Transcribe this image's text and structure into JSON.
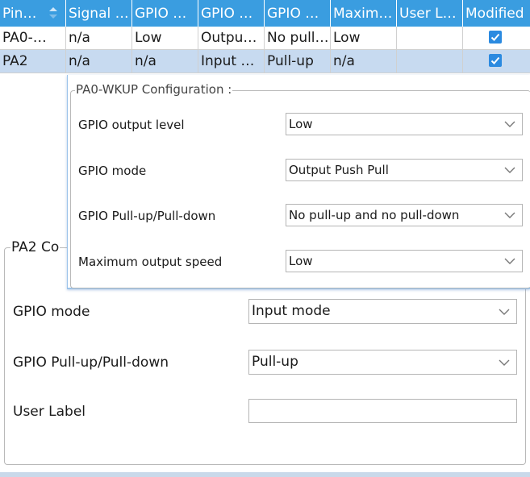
{
  "table": {
    "headers": [
      "Pin…",
      "Signal …",
      "GPIO …",
      "GPIO …",
      "GPIO …",
      "Maxim…",
      "User L…",
      "Modified"
    ],
    "rows": [
      {
        "pin": "PA0-…",
        "signal": "n/a",
        "gpio_level": "Low",
        "gpio_mode": "Outpu…",
        "gpio_pull": "No pull…",
        "max_speed": "Low",
        "user_label": "",
        "modified": true
      },
      {
        "pin": "PA2",
        "signal": "n/a",
        "gpio_level": "n/a",
        "gpio_mode": "Input …",
        "gpio_pull": "Pull-up",
        "max_speed": "n/a",
        "user_label": "",
        "modified": true
      }
    ]
  },
  "popup": {
    "title": "PA0-WKUP Configuration :",
    "fields": [
      {
        "label": "GPIO output level",
        "value": "Low"
      },
      {
        "label": "GPIO mode",
        "value": "Output Push Pull"
      },
      {
        "label": "GPIO Pull-up/Pull-down",
        "value": "No pull-up and no pull-down"
      },
      {
        "label": "Maximum output speed",
        "value": "Low"
      }
    ]
  },
  "pa2": {
    "title": "PA2 Co",
    "fields": [
      {
        "label": "GPIO mode",
        "value": "Input mode"
      },
      {
        "label": "GPIO Pull-up/Pull-down",
        "value": "Pull-up"
      }
    ],
    "user_label": {
      "label": "User Label",
      "value": ""
    }
  },
  "colors": {
    "header": "#3a9de0",
    "selected_row": "#c7daf0",
    "checkbox": "#2b8ae0"
  }
}
